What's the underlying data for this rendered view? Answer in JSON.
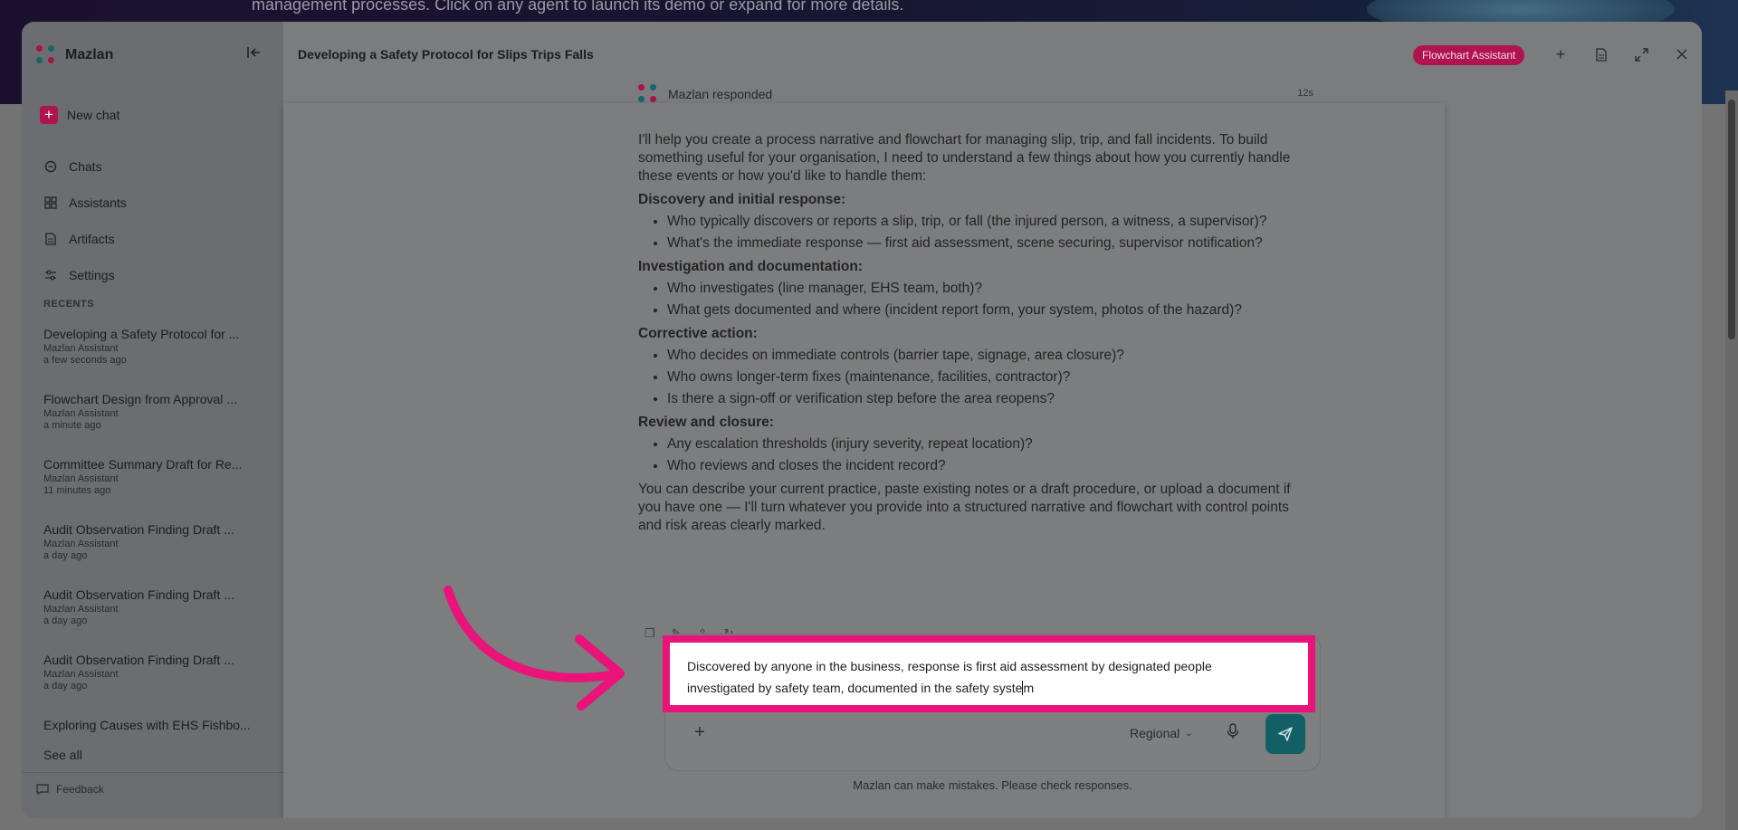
{
  "background": {
    "hero_text": "management processes. Click on any agent to launch its demo or expand for more details."
  },
  "sidebar": {
    "brand": "Mazlan",
    "new_chat": "New chat",
    "nav": [
      {
        "label": "Chats",
        "icon": "chat-icon"
      },
      {
        "label": "Assistants",
        "icon": "grid-icon"
      },
      {
        "label": "Artifacts",
        "icon": "document-icon"
      },
      {
        "label": "Settings",
        "icon": "sliders-icon"
      }
    ],
    "recents_title": "RECENTS",
    "recents": [
      {
        "title": "Developing a Safety Protocol for ...",
        "assistant": "Mazlan Assistant",
        "time": "a few seconds ago"
      },
      {
        "title": "Flowchart Design from Approval ...",
        "assistant": "Mazlan Assistant",
        "time": "a minute ago"
      },
      {
        "title": "Committee Summary Draft for Re...",
        "assistant": "Mazlan Assistant",
        "time": "11 minutes ago"
      },
      {
        "title": "Audit Observation Finding Draft ...",
        "assistant": "Mazlan Assistant",
        "time": "a day ago"
      },
      {
        "title": "Audit Observation Finding Draft ...",
        "assistant": "Mazlan Assistant",
        "time": "a day ago"
      },
      {
        "title": "Audit Observation Finding Draft ...",
        "assistant": "Mazlan Assistant",
        "time": "a day ago"
      },
      {
        "title": "Exploring Causes with EHS Fishbo...",
        "assistant": "",
        "time": ""
      }
    ],
    "see_all": "See all",
    "feedback": "Feedback"
  },
  "header": {
    "title": "Developing a Safety Protocol for Slips Trips Falls",
    "badge": "Flowchart Assistant"
  },
  "message": {
    "author": "Mazlan responded",
    "elapsed": "12s",
    "intro": "I'll help you create a process narrative and flowchart for managing slip, trip, and fall incidents. To build something useful for your organisation, I need to understand a few things about how you currently handle these events or how you'd like to handle them:",
    "sections": [
      {
        "heading": "Discovery and initial response:",
        "items": [
          "Who typically discovers or reports a slip, trip, or fall (the injured person, a witness, a supervisor)?",
          "What's the immediate response — first aid assessment, scene securing, supervisor notification?"
        ]
      },
      {
        "heading": "Investigation and documentation:",
        "items": [
          "Who investigates (line manager, EHS team, both)?",
          "What gets documented and where (incident report form, your system, photos of the hazard)?"
        ]
      },
      {
        "heading": "Corrective action:",
        "items": [
          "Who decides on immediate controls (barrier tape, signage, area closure)?",
          "Who owns longer-term fixes (maintenance, facilities, contractor)?",
          "Is there a sign-off or verification step before the area reopens?"
        ]
      },
      {
        "heading": "Review and closure:",
        "items": [
          "Any escalation thresholds (injury severity, repeat location)?",
          "Who reviews and closes the incident record?"
        ]
      }
    ],
    "outro": "You can describe your current practice, paste existing notes or a draft procedure, or upload a document if you have one — I'll turn whatever you provide into a structured narrative and flowchart with control points and risk areas clearly marked."
  },
  "composer": {
    "text_line1": "Discovered by anyone in the business, response is first aid assessment by designated people",
    "text_line2_before_caret": "investigated by safety team, documented in the safety syste",
    "text_line2_after_caret": "m",
    "region": "Regional",
    "disclaimer": "Mazlan can make mistakes. Please check responses."
  },
  "colors": {
    "accent": "#b0134f",
    "highlight": "#e9137a",
    "send": "#126066"
  }
}
